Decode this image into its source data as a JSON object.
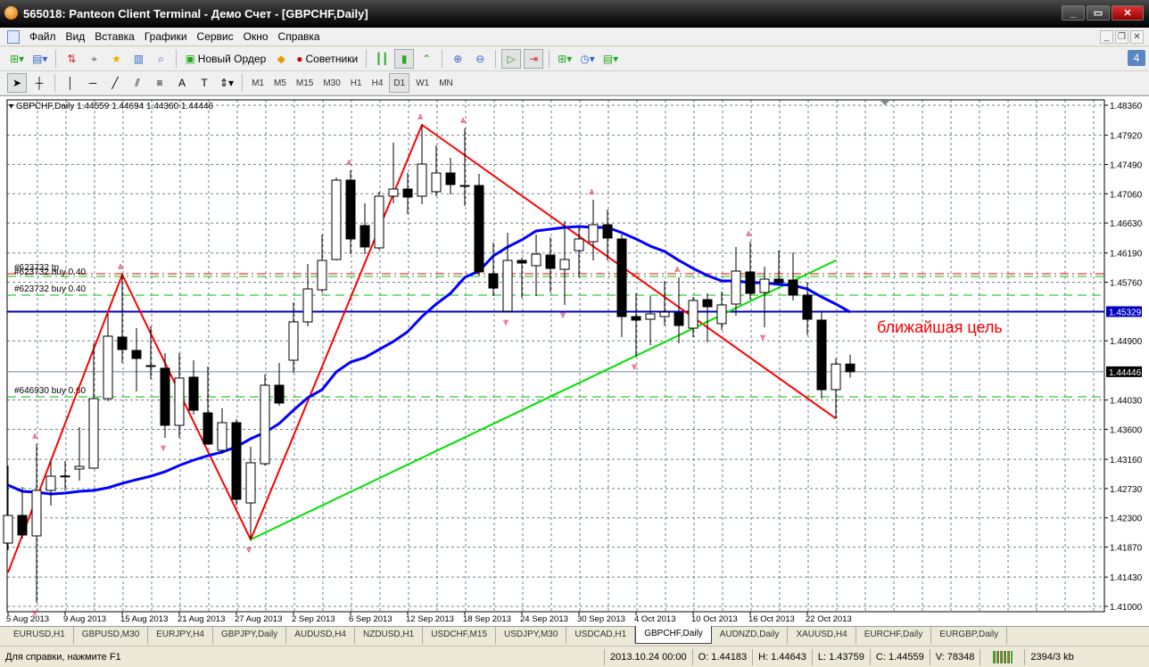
{
  "window": {
    "title": "565018: Panteon Client Terminal - Демо Счет - [GBPCHF,Daily]"
  },
  "menu": [
    "Файл",
    "Вид",
    "Вставка",
    "Графики",
    "Сервис",
    "Окно",
    "Справка"
  ],
  "toolbar": {
    "new_order": "Новый Ордер",
    "experts": "Советники",
    "timeframes": [
      "M1",
      "M5",
      "M15",
      "M30",
      "H1",
      "H4",
      "D1",
      "W1",
      "MN"
    ],
    "active_timeframe": "D1",
    "notification_count": "4"
  },
  "chart": {
    "header": "GBPCHF,Daily  1.44559 1.44694 1.44360 1.44446",
    "price_ticks": [
      "1.48360",
      "1.47920",
      "1.47490",
      "1.47060",
      "1.46630",
      "1.46190",
      "1.45760",
      "1.44900",
      "1.44030",
      "1.43600",
      "1.43160",
      "1.42730",
      "1.42300",
      "1.41870",
      "1.41430",
      "1.41000"
    ],
    "price_tick_values": [
      1.4836,
      1.4792,
      1.4749,
      1.4706,
      1.4663,
      1.4619,
      1.4576,
      1.449,
      1.4403,
      1.436,
      1.4316,
      1.4273,
      1.423,
      1.4187,
      1.4143,
      1.41
    ],
    "hline_label": "1.45329",
    "hline_value": 1.45329,
    "bid_label": "1.44446",
    "bid_value": 1.44446,
    "date_labels": [
      {
        "bar": 0,
        "text": "5 Aug 2013"
      },
      {
        "bar": 4,
        "text": "9 Aug 2013"
      },
      {
        "bar": 8,
        "text": "15 Aug 2013"
      },
      {
        "bar": 12,
        "text": "21 Aug 2013"
      },
      {
        "bar": 16,
        "text": "27 Aug 2013"
      },
      {
        "bar": 20,
        "text": "2 Sep 2013"
      },
      {
        "bar": 24,
        "text": "6 Sep 2013"
      },
      {
        "bar": 28,
        "text": "12 Sep 2013"
      },
      {
        "bar": 32,
        "text": "18 Sep 2013"
      },
      {
        "bar": 36,
        "text": "24 Sep 2013"
      },
      {
        "bar": 40,
        "text": "30 Sep 2013"
      },
      {
        "bar": 44,
        "text": "4 Oct 2013"
      },
      {
        "bar": 48,
        "text": "10 Oct 2013"
      },
      {
        "bar": 52,
        "text": "16 Oct 2013"
      },
      {
        "bar": 56,
        "text": "22 Oct 2013"
      }
    ],
    "ohlc": [
      [
        1.4193,
        1.43069,
        1.41825,
        1.42336
      ],
      [
        1.42336,
        1.42755,
        1.41995,
        1.42048
      ],
      [
        1.42035,
        1.43384,
        1.41052,
        1.42703
      ],
      [
        1.42703,
        1.43122,
        1.4248,
        1.42912
      ],
      [
        1.42912,
        1.43135,
        1.42703,
        1.42915
      ],
      [
        1.43017,
        1.43632,
        1.42847,
        1.43056
      ],
      [
        1.4303,
        1.44863,
        1.4302,
        1.44051
      ],
      [
        1.44051,
        1.45296,
        1.44012,
        1.44968
      ],
      [
        1.44955,
        1.45872,
        1.44575,
        1.44772
      ],
      [
        1.44759,
        1.45086,
        1.44156,
        1.44641
      ],
      [
        1.44536,
        1.45112,
        1.4434,
        1.4453
      ],
      [
        1.44497,
        1.44719,
        1.43475,
        1.43659
      ],
      [
        1.43659,
        1.44719,
        1.43475,
        1.44353
      ],
      [
        1.44366,
        1.44615,
        1.43816,
        1.43881
      ],
      [
        1.43842,
        1.44523,
        1.4337,
        1.43384
      ],
      [
        1.43292,
        1.43907,
        1.4324,
        1.43698
      ],
      [
        1.43698,
        1.4375,
        1.4248,
        1.42572
      ],
      [
        1.42519,
        1.43344,
        1.41982,
        1.43109
      ],
      [
        1.43095,
        1.44405,
        1.43069,
        1.44248
      ],
      [
        1.44248,
        1.44575,
        1.43947,
        1.43986
      ],
      [
        1.44615,
        1.45466,
        1.44431,
        1.45178
      ],
      [
        1.45178,
        1.46029,
        1.45112,
        1.45662
      ],
      [
        1.45649,
        1.46461,
        1.4561,
        1.46081
      ],
      [
        1.46094,
        1.47299,
        1.46081,
        1.4726
      ],
      [
        1.4726,
        1.47404,
        1.46173,
        1.46396
      ],
      [
        1.46592,
        1.46919,
        1.46173,
        1.46278
      ],
      [
        1.46265,
        1.4709,
        1.46238,
        1.47024
      ],
      [
        1.47024,
        1.4781,
        1.46919,
        1.47129
      ],
      [
        1.47129,
        1.47365,
        1.46762,
        1.47011
      ],
      [
        1.47024,
        1.48072,
        1.46906,
        1.47496
      ],
      [
        1.4709,
        1.47771,
        1.47024,
        1.47365
      ],
      [
        1.47365,
        1.47587,
        1.4705,
        1.47195
      ],
      [
        1.47181,
        1.4802,
        1.4688,
        1.47175
      ],
      [
        1.47181,
        1.47352,
        1.45859,
        1.45911
      ],
      [
        1.45885,
        1.46343,
        1.45557,
        1.45675
      ],
      [
        1.45335,
        1.46487,
        1.45322,
        1.46081
      ],
      [
        1.46081,
        1.46121,
        1.45531,
        1.46042
      ],
      [
        1.46003,
        1.46461,
        1.45557,
        1.46173
      ],
      [
        1.4616,
        1.46422,
        1.4561,
        1.45963
      ],
      [
        1.4595,
        1.46658,
        1.45427,
        1.46094
      ],
      [
        1.46225,
        1.46579,
        1.45833,
        1.46396
      ],
      [
        1.46356,
        1.46972,
        1.46081,
        1.46605
      ],
      [
        1.46605,
        1.46828,
        1.46081,
        1.46409
      ],
      [
        1.46396,
        1.46461,
        1.44955,
        1.45256
      ],
      [
        1.45256,
        1.45597,
        1.44667,
        1.45204
      ],
      [
        1.45217,
        1.45557,
        1.44837,
        1.45296
      ],
      [
        1.45256,
        1.4578,
        1.45125,
        1.45322
      ],
      [
        1.45309,
        1.45833,
        1.44863,
        1.45125
      ],
      [
        1.45086,
        1.45544,
        1.44955,
        1.45492
      ],
      [
        1.45505,
        1.45597,
        1.44877,
        1.454
      ],
      [
        1.45152,
        1.45623,
        1.4506,
        1.45427
      ],
      [
        1.4544,
        1.46278,
        1.45269,
        1.45924
      ],
      [
        1.45911,
        1.46356,
        1.45505,
        1.45597
      ],
      [
        1.4561,
        1.4599,
        1.45099,
        1.45806
      ],
      [
        1.45806,
        1.46225,
        1.45741,
        1.45754
      ],
      [
        1.45793,
        1.46199,
        1.45492,
        1.45571
      ],
      [
        1.45571,
        1.45754,
        1.44981,
        1.45217
      ],
      [
        1.45204,
        1.45322,
        1.44051,
        1.44182
      ],
      [
        1.44183,
        1.44643,
        1.43759,
        1.44559
      ],
      [
        1.44559,
        1.44694,
        1.4436,
        1.44446
      ]
    ],
    "ma": [
      1.42781,
      1.42689,
      1.42676,
      1.4265,
      1.42663,
      1.42689,
      1.42703,
      1.42742,
      1.42807,
      1.4286,
      1.42912,
      1.42978,
      1.43069,
      1.43148,
      1.43213,
      1.43266,
      1.43344,
      1.43462,
      1.43554,
      1.43685,
      1.43881,
      1.44065,
      1.44182,
      1.44444,
      1.44588,
      1.44654,
      1.44772,
      1.4489,
      1.45034,
      1.45256,
      1.4544,
      1.45597,
      1.45833,
      1.45924,
      1.46147,
      1.46278,
      1.46383,
      1.46514,
      1.4654,
      1.46566,
      1.46579,
      1.46566,
      1.46566,
      1.46487,
      1.46396,
      1.46291,
      1.46212,
      1.46081,
      1.45963,
      1.45859,
      1.4578,
      1.4578,
      1.45754,
      1.45754,
      1.45728,
      1.45715,
      1.45662,
      1.45544,
      1.4544,
      1.45322
    ],
    "zigzag": [
      [
        0,
        1.41498
      ],
      [
        8,
        1.45872
      ],
      [
        17,
        1.41982
      ],
      [
        29,
        1.48072
      ],
      [
        58,
        1.43759
      ]
    ],
    "trendline": [
      [
        17,
        1.41982
      ],
      [
        58,
        1.46081
      ]
    ],
    "fractals_up": [
      2,
      8,
      24,
      29,
      32,
      41,
      47,
      52
    ],
    "fractals_down": [
      2,
      11,
      17,
      35,
      39,
      44,
      53
    ],
    "order_lines": [
      {
        "price": 1.45885,
        "color": "#ff0000",
        "label": "#623732 tp"
      },
      {
        "price": 1.45846,
        "color": "#00c000",
        "label": "#623732 buy 0.40"
      },
      {
        "price": 1.45571,
        "color": "#00c000",
        "label": "#623732 buy 0.40"
      },
      {
        "price": 1.44078,
        "color": "#00c000",
        "label": "#646930 buy 0.60"
      }
    ],
    "annotation": "ближайшая цель",
    "colors": {
      "zigzag": "#ff0000",
      "ma": "#0000ff",
      "trend": "#00e000",
      "hline": "#0000c0",
      "grid": "#708090"
    }
  },
  "tabs": [
    "EURUSD,H1",
    "GBPUSD,M30",
    "EURJPY,H4",
    "GBPJPY,Daily",
    "AUDUSD,H4",
    "NZDUSD,H1",
    "USDCHF,M15",
    "USDJPY,M30",
    "USDCAD,H1",
    "GBPCHF,Daily",
    "AUDNZD,Daily",
    "XAUUSD,H4",
    "EURCHF,Daily",
    "EURGBP,Daily"
  ],
  "active_tab": "GBPCHF,Daily",
  "status": {
    "help": "Для справки, нажмите F1",
    "datetime": "2013.10.24 00:00",
    "open": "O: 1.44183",
    "high": "H: 1.44643",
    "low": "L: 1.43759",
    "close": "C: 1.44559",
    "volume": "V: 78348",
    "traffic": "2394/3 kb"
  }
}
